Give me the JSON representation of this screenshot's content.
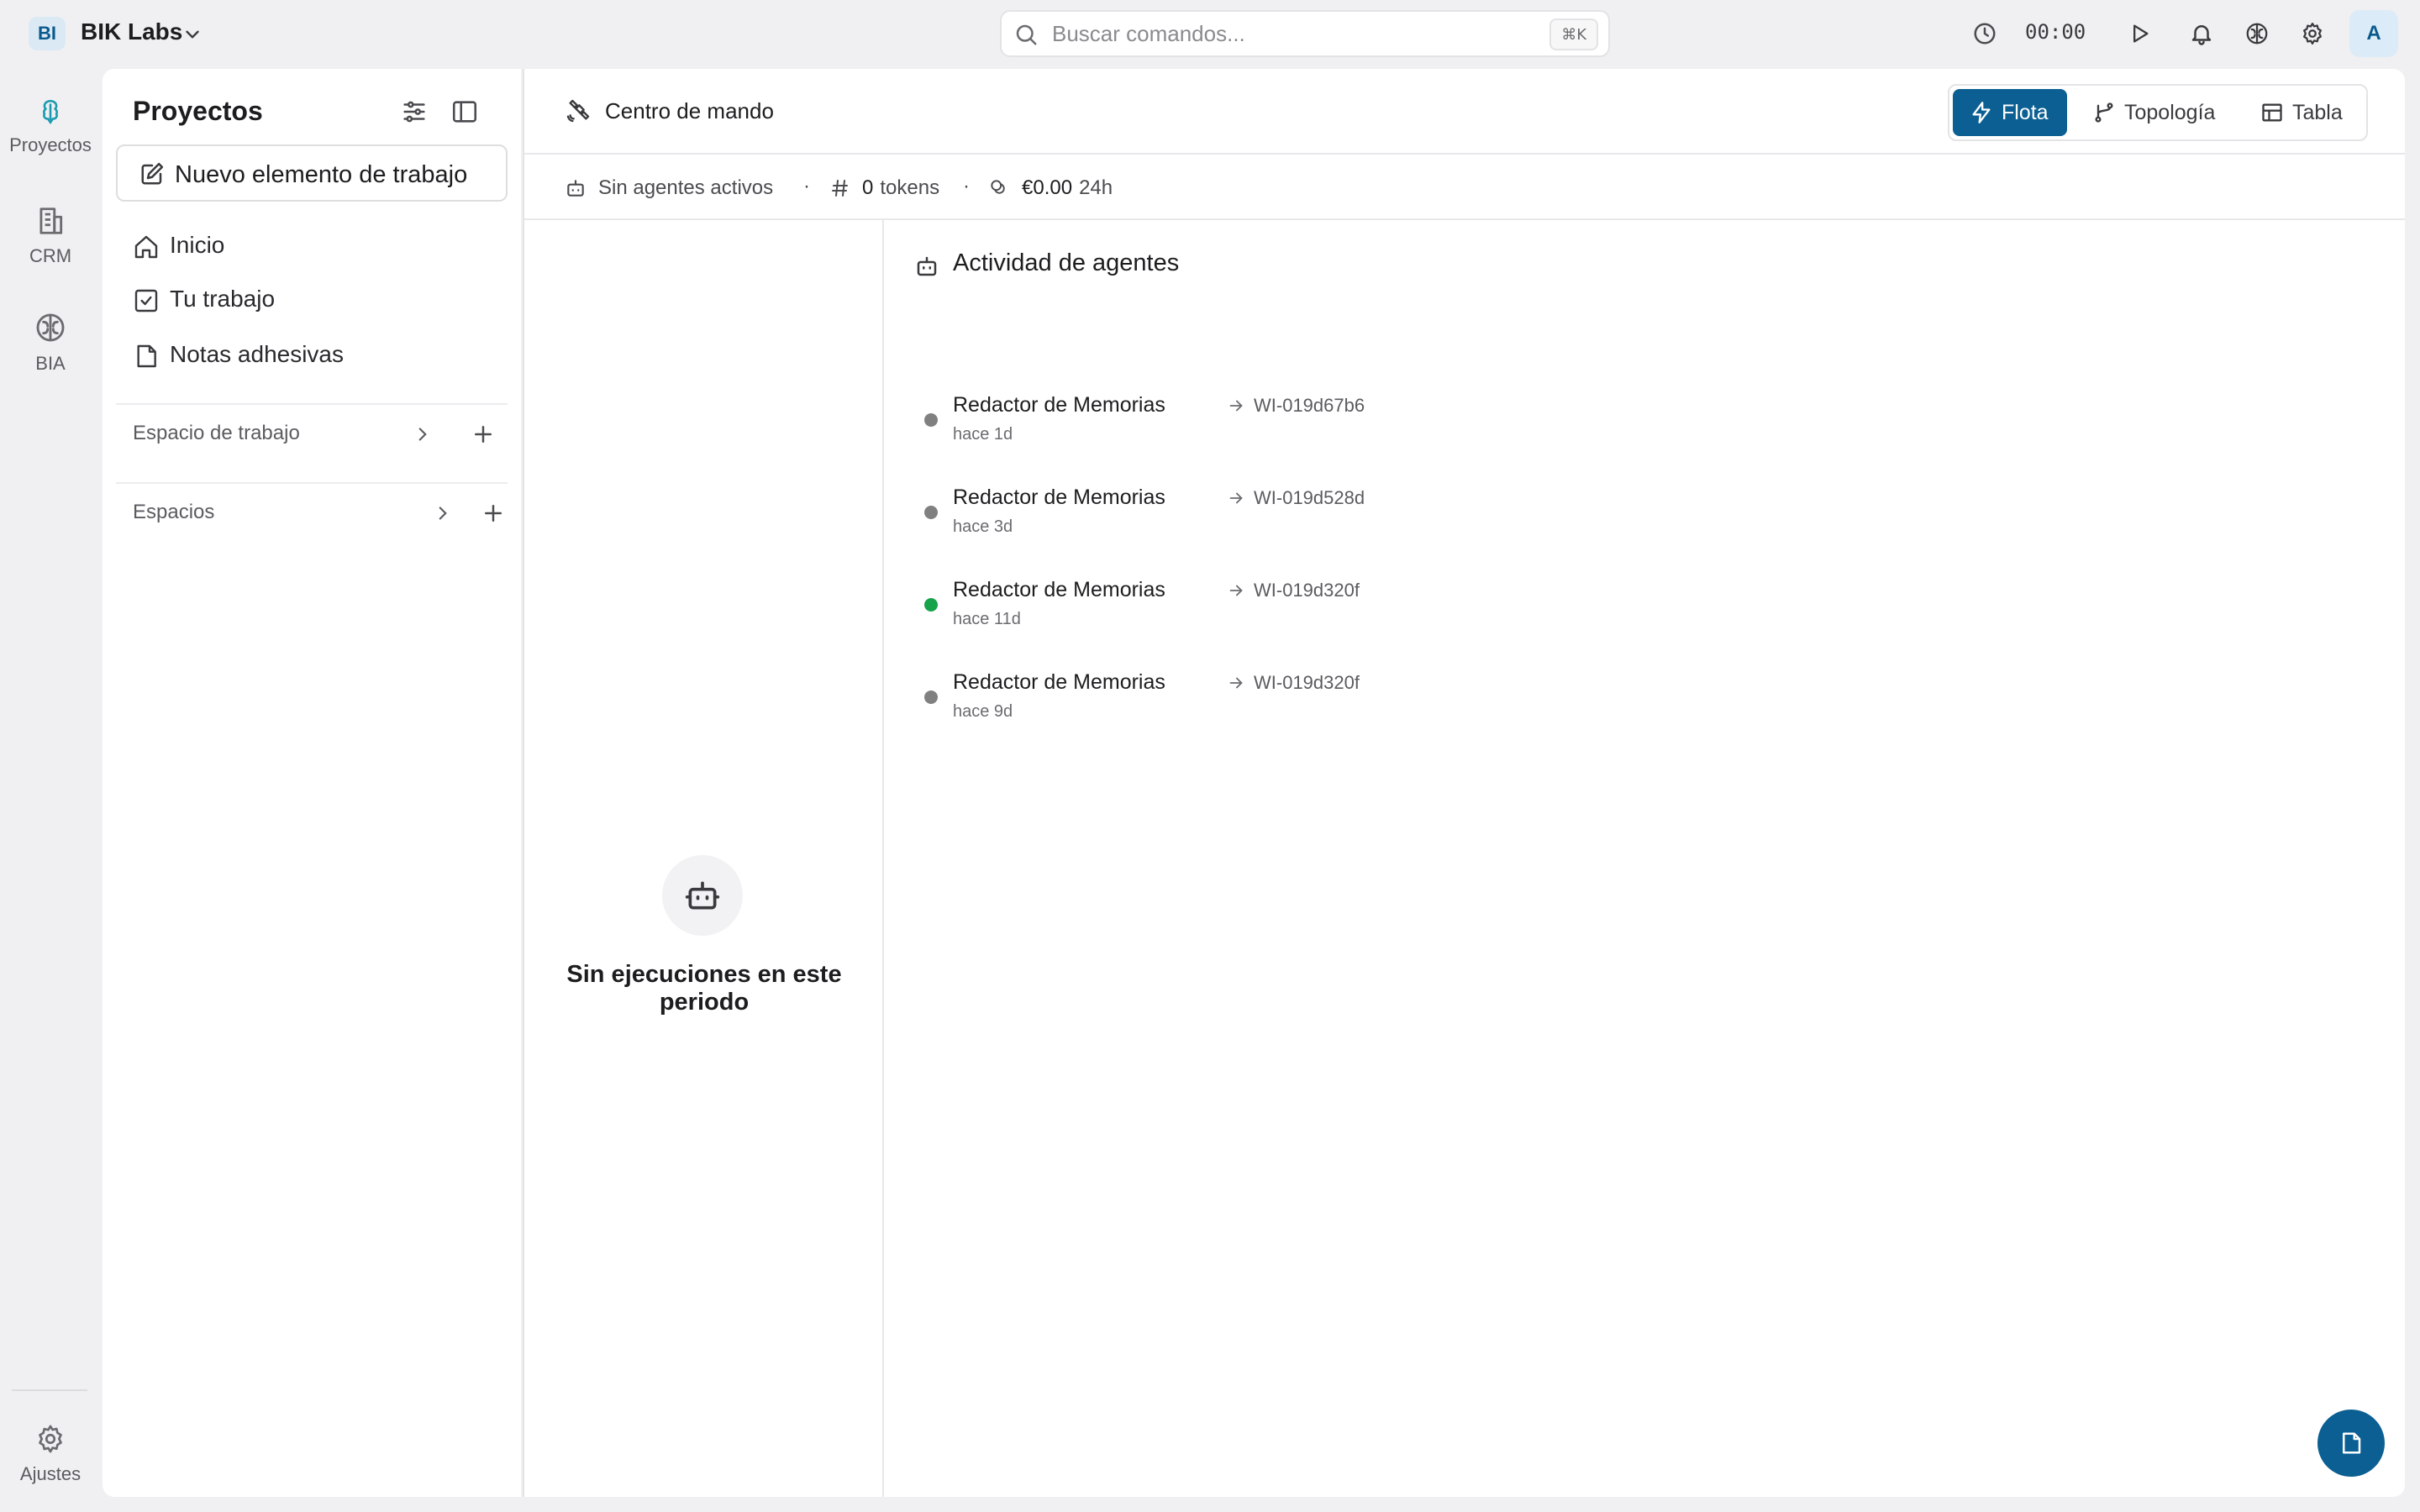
{
  "org": {
    "badge": "BI",
    "name": "BIK Labs"
  },
  "search": {
    "placeholder": "Buscar comandos...",
    "value": "",
    "shortcut": "⌘K"
  },
  "topbar": {
    "timer": "00:00",
    "avatar": "A"
  },
  "rail": {
    "items": [
      {
        "label": "Proyectos",
        "icon": "projects-icon"
      },
      {
        "label": "CRM",
        "icon": "building-icon"
      },
      {
        "label": "BIA",
        "icon": "brain-icon"
      }
    ],
    "settings_label": "Ajustes"
  },
  "sidebar": {
    "title": "Proyectos",
    "new_item_label": "Nuevo elemento de trabajo",
    "nav": [
      {
        "label": "Inicio",
        "icon": "home-icon"
      },
      {
        "label": "Tu trabajo",
        "icon": "checkbox-icon"
      },
      {
        "label": "Notas adhesivas",
        "icon": "note-icon"
      }
    ],
    "sections": [
      {
        "label": "Espacio de trabajo"
      },
      {
        "label": "Espacios"
      }
    ]
  },
  "main": {
    "title": "Centro de mando",
    "views": [
      {
        "label": "Flota",
        "active": true
      },
      {
        "label": "Topología",
        "active": false
      },
      {
        "label": "Tabla",
        "active": false
      }
    ],
    "stats": {
      "agents": "Sin agentes activos",
      "tokens_value": "0",
      "tokens_label": "tokens",
      "cost_value": "€0.00",
      "cost_period": "24h",
      "separator": "·"
    },
    "empty_state": "Sin ejecuciones en este periodo",
    "activity": {
      "title": "Actividad de agentes",
      "items": [
        {
          "agent": "Redactor de Memorias",
          "ref": "WI-019d67b6",
          "time": "hace 1d",
          "status": "idle"
        },
        {
          "agent": "Redactor de Memorias",
          "ref": "WI-019d528d",
          "time": "hace 3d",
          "status": "idle"
        },
        {
          "agent": "Redactor de Memorias",
          "ref": "WI-019d320f",
          "time": "hace 11d",
          "status": "success"
        },
        {
          "agent": "Redactor de Memorias",
          "ref": "WI-019d320f",
          "time": "hace 9d",
          "status": "idle"
        }
      ]
    }
  },
  "colors": {
    "accent": "#0b5f92",
    "status_idle": "#808080",
    "status_success": "#16a34a"
  }
}
